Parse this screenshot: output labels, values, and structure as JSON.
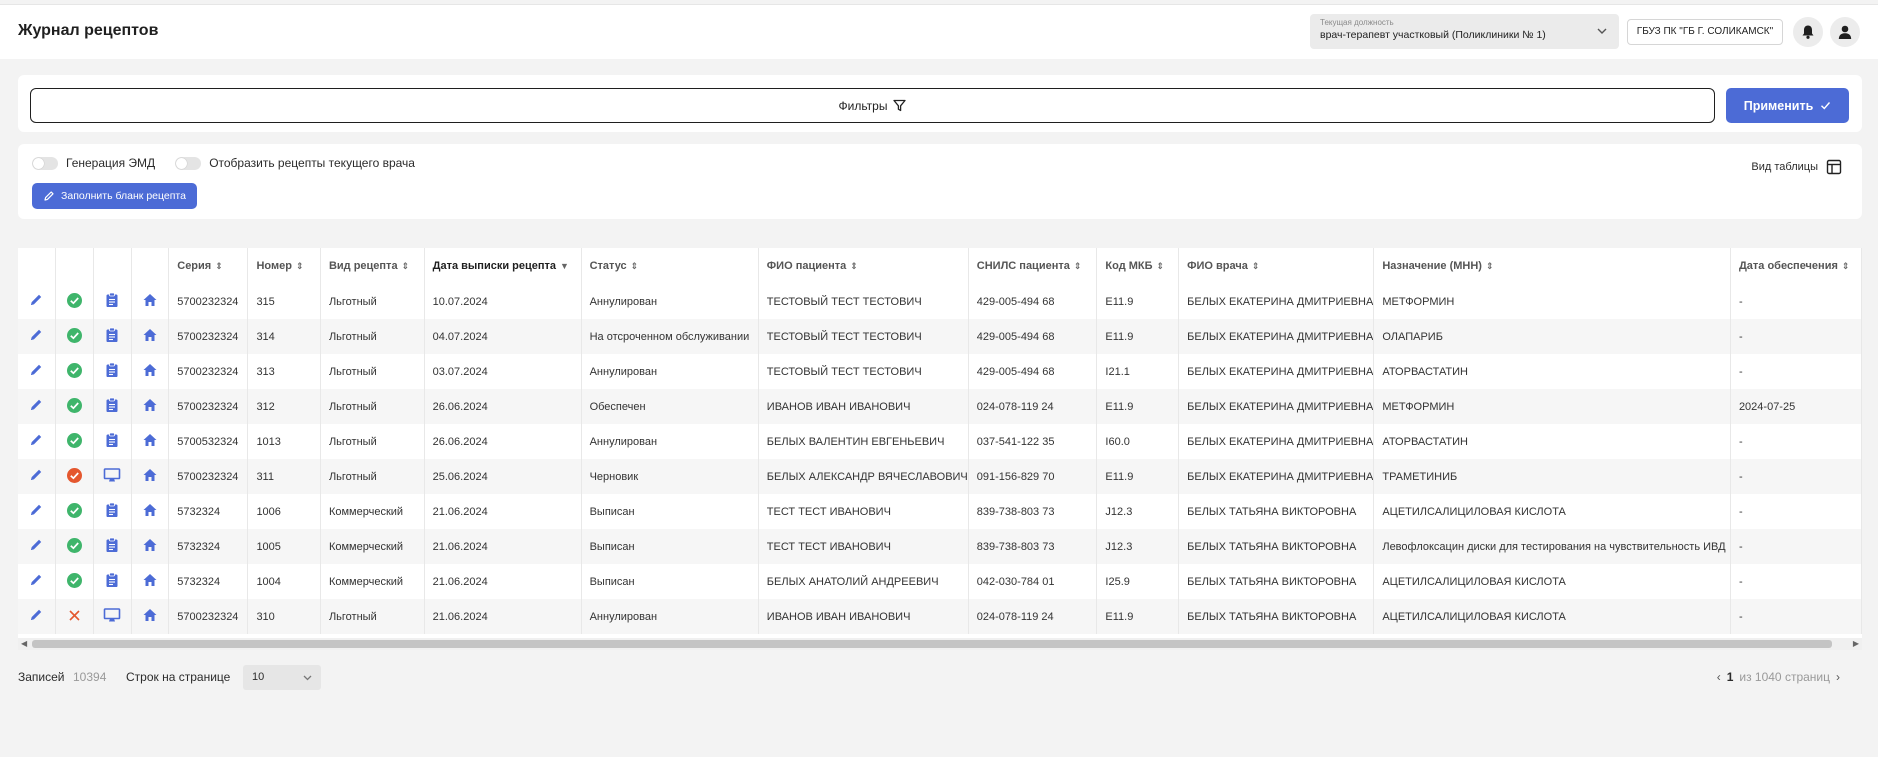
{
  "header": {
    "title": "Журнал рецептов",
    "position_caption": "Текущая должность",
    "position_value": "врач-терапевт участковый (Поликлиники № 1)",
    "organization": "ГБУЗ ПК \"ГБ Г. СОЛИКАМСК\""
  },
  "filters": {
    "label": "Фильтры",
    "apply_label": "Применить"
  },
  "options": {
    "toggle_emd": "Генерация ЭМД",
    "toggle_current_doctor": "Отобразить рецепты текущего врача",
    "fill_form_label": "Заполнить бланк рецепта",
    "view_table_label": "Вид таблицы"
  },
  "table": {
    "columns": [
      "Серия",
      "Номер",
      "Вид рецепта",
      "Дата выписки рецепта",
      "Статус",
      "ФИО пациента",
      "СНИЛС пациента",
      "Код МКБ",
      "ФИО врача",
      "Назначение (МНН)",
      "Дата обеспечения"
    ],
    "rows": [
      {
        "status_icon": "check",
        "doc_icon": "clipboard",
        "series": "5700232324",
        "number": "315",
        "type": "Льготный",
        "date": "10.07.2024",
        "status": "Аннулирован",
        "patient": "ТЕСТОВЫЙ ТЕСТ ТЕСТОВИЧ",
        "snils": "429-005-494 68",
        "mkb": "E11.9",
        "doctor": "БЕЛЫХ ЕКАТЕРИНА ДМИТРИЕВНА",
        "drug": "МЕТФОРМИН",
        "supply_date": "-"
      },
      {
        "status_icon": "check",
        "doc_icon": "clipboard",
        "series": "5700232324",
        "number": "314",
        "type": "Льготный",
        "date": "04.07.2024",
        "status": "На отсроченном обслуживании",
        "patient": "ТЕСТОВЫЙ ТЕСТ ТЕСТОВИЧ",
        "snils": "429-005-494 68",
        "mkb": "E11.9",
        "doctor": "БЕЛЫХ ЕКАТЕРИНА ДМИТРИЕВНА",
        "drug": "ОЛАПАРИБ",
        "supply_date": "-"
      },
      {
        "status_icon": "check",
        "doc_icon": "clipboard",
        "series": "5700232324",
        "number": "313",
        "type": "Льготный",
        "date": "03.07.2024",
        "status": "Аннулирован",
        "patient": "ТЕСТОВЫЙ ТЕСТ ТЕСТОВИЧ",
        "snils": "429-005-494 68",
        "mkb": "I21.1",
        "doctor": "БЕЛЫХ ЕКАТЕРИНА ДМИТРИЕВНА",
        "drug": "АТОРВАСТАТИН",
        "supply_date": "-"
      },
      {
        "status_icon": "check",
        "doc_icon": "clipboard",
        "series": "5700232324",
        "number": "312",
        "type": "Льготный",
        "date": "26.06.2024",
        "status": "Обеспечен",
        "patient": "ИВАНОВ ИВАН ИВАНОВИЧ",
        "snils": "024-078-119 24",
        "mkb": "E11.9",
        "doctor": "БЕЛЫХ ЕКАТЕРИНА ДМИТРИЕВНА",
        "drug": "МЕТФОРМИН",
        "supply_date": "2024-07-25"
      },
      {
        "status_icon": "check",
        "doc_icon": "clipboard",
        "series": "5700532324",
        "number": "1013",
        "type": "Льготный",
        "date": "26.06.2024",
        "status": "Аннулирован",
        "patient": "БЕЛЫХ ВАЛЕНТИН ЕВГЕНЬЕВИЧ",
        "snils": "037-541-122 35",
        "mkb": "I60.0",
        "doctor": "БЕЛЫХ ЕКАТЕРИНА ДМИТРИЕВНА",
        "drug": "АТОРВАСТАТИН",
        "supply_date": "-"
      },
      {
        "status_icon": "error",
        "doc_icon": "monitor",
        "series": "5700232324",
        "number": "311",
        "type": "Льготный",
        "date": "25.06.2024",
        "status": "Черновик",
        "patient": "БЕЛЫХ АЛЕКСАНДР ВЯЧЕСЛАВОВИЧ",
        "snils": "091-156-829 70",
        "mkb": "E11.9",
        "doctor": "БЕЛЫХ ЕКАТЕРИНА ДМИТРИЕВНА",
        "drug": "ТРАМЕТИНИБ",
        "supply_date": "-"
      },
      {
        "status_icon": "check",
        "doc_icon": "clipboard",
        "series": "5732324",
        "number": "1006",
        "type": "Коммерческий",
        "date": "21.06.2024",
        "status": "Выписан",
        "patient": "ТЕСТ ТЕСТ ИВАНОВИЧ",
        "snils": "839-738-803 73",
        "mkb": "J12.3",
        "doctor": "БЕЛЫХ ТАТЬЯНА ВИКТОРОВНА",
        "drug": "АЦЕТИЛСАЛИЦИЛОВАЯ КИСЛОТА",
        "supply_date": "-"
      },
      {
        "status_icon": "check",
        "doc_icon": "clipboard",
        "series": "5732324",
        "number": "1005",
        "type": "Коммерческий",
        "date": "21.06.2024",
        "status": "Выписан",
        "patient": "ТЕСТ ТЕСТ ИВАНОВИЧ",
        "snils": "839-738-803 73",
        "mkb": "J12.3",
        "doctor": "БЕЛЫХ ТАТЬЯНА ВИКТОРОВНА",
        "drug": "Левофлоксацин диски для тестирования на чувствительность ИВД",
        "supply_date": "-"
      },
      {
        "status_icon": "check",
        "doc_icon": "clipboard",
        "series": "5732324",
        "number": "1004",
        "type": "Коммерческий",
        "date": "21.06.2024",
        "status": "Выписан",
        "patient": "БЕЛЫХ АНАТОЛИЙ АНДРЕЕВИЧ",
        "snils": "042-030-784 01",
        "mkb": "I25.9",
        "doctor": "БЕЛЫХ ТАТЬЯНА ВИКТОРОВНА",
        "drug": "АЦЕТИЛСАЛИЦИЛОВАЯ КИСЛОТА",
        "supply_date": "-"
      },
      {
        "status_icon": "cross",
        "doc_icon": "monitor",
        "series": "5700232324",
        "number": "310",
        "type": "Льготный",
        "date": "21.06.2024",
        "status": "Аннулирован",
        "patient": "ИВАНОВ ИВАН ИВАНОВИЧ",
        "snils": "024-078-119 24",
        "mkb": "E11.9",
        "doctor": "БЕЛЫХ ТАТЬЯНА ВИКТОРОВНА",
        "drug": "АЦЕТИЛСАЛИЦИЛОВАЯ КИСЛОТА",
        "supply_date": "-"
      }
    ]
  },
  "pager": {
    "records_label": "Записей",
    "records_count": "10394",
    "rows_per_page_label": "Строк на странице",
    "rows_per_page_value": "10",
    "current_page": "1",
    "total_pages_text": "из 1040 страниц"
  },
  "colors": {
    "accent": "#4c6bd6",
    "success": "#3fb56b",
    "error": "#e4572e"
  }
}
